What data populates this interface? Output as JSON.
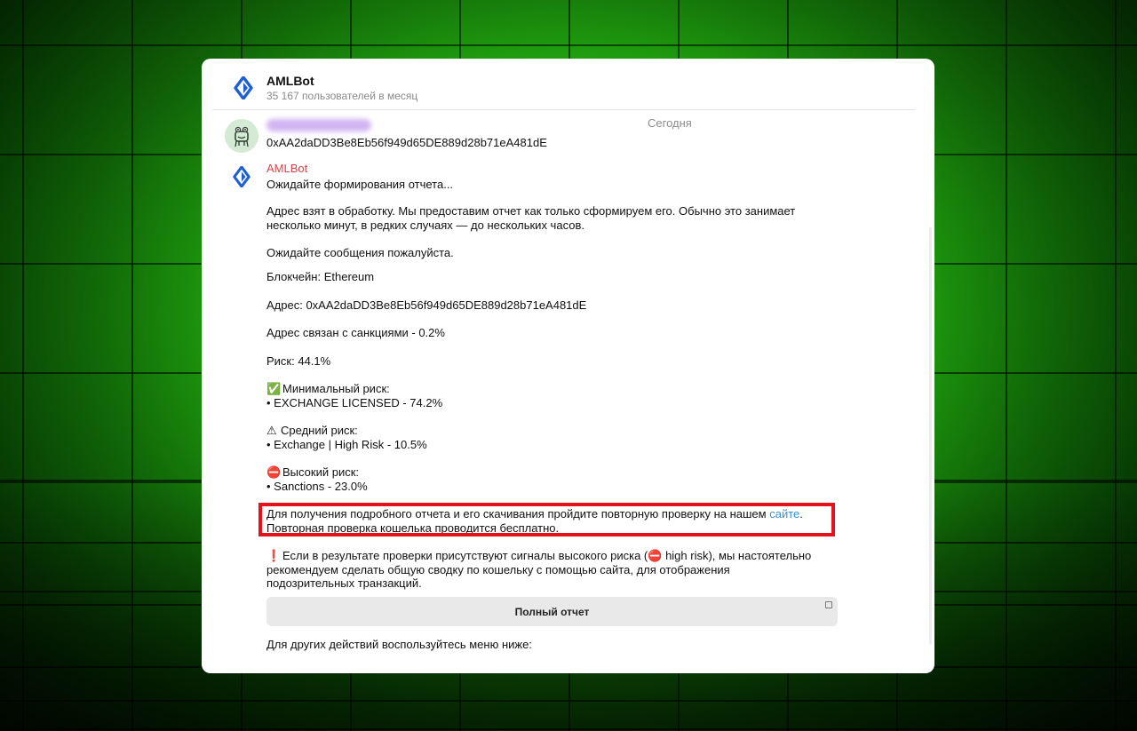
{
  "app": {
    "title": "AMLBot",
    "subtitle": "35 167 пользователей в месяц"
  },
  "chat": {
    "date": "Сегодня",
    "user_message": "0xAA2daDD3Be8Eb56f949d65DE889d28b71eA481dE",
    "bot_name": "AMLBot",
    "bot_lines": {
      "waiting": "Ожидайте формирования отчета...",
      "processing_1": "Адрес взят в обработку. Мы предоставим отчет как только сформируем его. Обычно это занимает",
      "processing_2": "несколько минут, в редких случаях — до нескольких часов.",
      "please_wait": "Ожидайте сообщения пожалуйста.",
      "blockchain": "Блокчейн: Ethereum",
      "address": "Адрес: 0xAA2daDD3Be8Eb56f949d65DE889d28b71eA481dE",
      "sanctions_link": "Адрес связан с санкциями - 0.2%",
      "risk": "Риск: 44.1%",
      "min_risk_icon": "✅",
      "min_risk_title": "Минимальный риск:",
      "min_risk_item": "• EXCHANGE LICENSED - 74.2%",
      "mid_risk_icon": "⚠",
      "mid_risk_title": "Средний риск:",
      "mid_risk_item": "• Exchange | High Risk - 10.5%",
      "high_risk_icon": "⛔",
      "high_risk_title": "Высокий риск:",
      "high_risk_item": "• Sanctions - 23.0%",
      "detail_1": "Для получения подробного отчета и его скачивания пройдите повторную проверку на нашем ",
      "detail_link": "сайте",
      "detail_1_end": ".",
      "detail_2": "Повторная проверка кошелька проводится бесплатно.",
      "warn_icon": "❗",
      "warn_1a": "Если в результате проверки присутствуют сигналы высокого риска (",
      "warn_1_icon": "⛔",
      "warn_1b": " high risk), мы настоятельно",
      "warn_2": "рекомендуем сделать общую сводку по кошельку с помощью сайта, для отображения",
      "warn_3": "подозрительных транзакций.",
      "other_actions": "Для других действий воспользуйтесь меню ниже:"
    },
    "full_report_button": "Полный отчет"
  },
  "colors": {
    "bot_name": "#d9454b",
    "link": "#3a8fd6",
    "highlight_border": "#e3121b",
    "logo_blue": "#1f5fd6"
  }
}
